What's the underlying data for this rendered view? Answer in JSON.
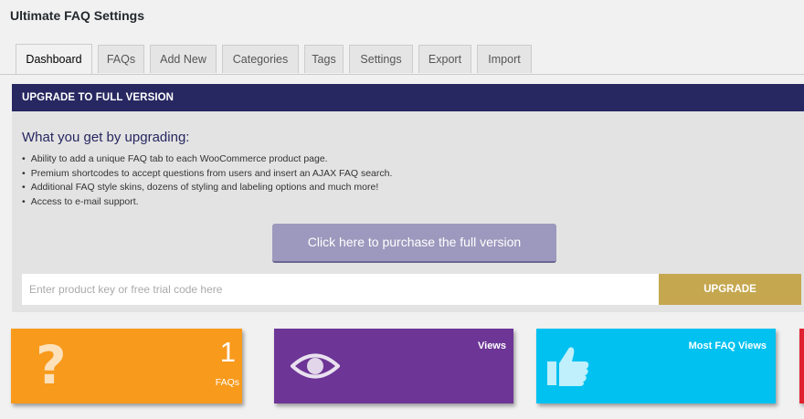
{
  "page": {
    "title": "Ultimate FAQ Settings"
  },
  "tabs": [
    {
      "label": "Dashboard",
      "active": true
    },
    {
      "label": "FAQs"
    },
    {
      "label": "Add New"
    },
    {
      "label": "Categories"
    },
    {
      "label": "Tags"
    },
    {
      "label": "Settings"
    },
    {
      "label": "Export"
    },
    {
      "label": "Import"
    }
  ],
  "upgrade": {
    "header": "UPGRADE TO FULL VERSION",
    "heading": "What you get by upgrading:",
    "benefits": [
      "Ability to add a unique FAQ tab to each WooCommerce product page.",
      "Premium shortcodes to accept questions from users and insert an AJAX FAQ search.",
      "Additional FAQ style skins, dozens of styling and labeling options and much more!",
      "Access to e-mail support."
    ],
    "purchase_label": "Click here to purchase the full version",
    "key_placeholder": "Enter product key or free trial code here",
    "key_value": "",
    "upgrade_label": "UPGRADE"
  },
  "stats": {
    "faqs": {
      "count": "1",
      "label": "FAQs",
      "icon": "question-mark-icon",
      "color": "#f89a1c"
    },
    "views": {
      "title": "Views",
      "icon": "eye-icon",
      "color": "#6d3596"
    },
    "most_views": {
      "title": "Most FAQ Views",
      "icon": "thumbs-up-icon",
      "color": "#00c1f0"
    },
    "fourth": {
      "color": "#e0212f"
    }
  },
  "colors": {
    "header_bg": "#272761",
    "heading_text": "#272761",
    "purchase_button": "#9d98bd",
    "upgrade_button": "#c5a74f"
  }
}
